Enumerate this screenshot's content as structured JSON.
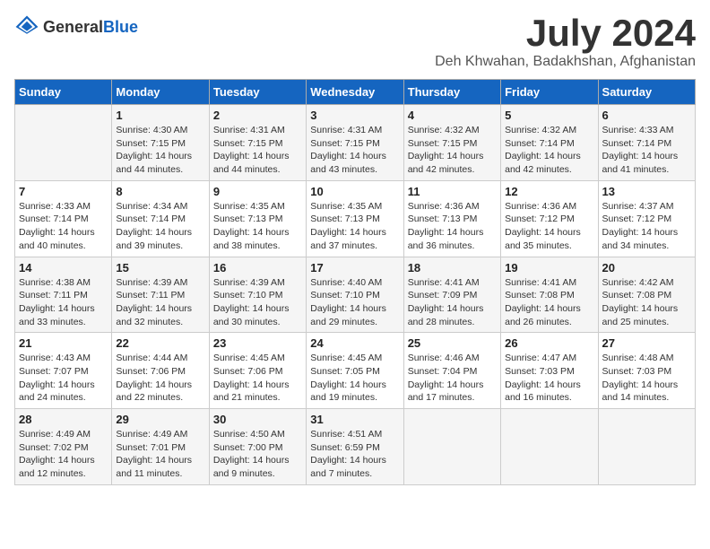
{
  "header": {
    "logo_general": "General",
    "logo_blue": "Blue",
    "month_year": "July 2024",
    "location": "Deh Khwahan, Badakhshan, Afghanistan"
  },
  "days_of_week": [
    "Sunday",
    "Monday",
    "Tuesday",
    "Wednesday",
    "Thursday",
    "Friday",
    "Saturday"
  ],
  "weeks": [
    [
      {
        "day": "",
        "info": ""
      },
      {
        "day": "1",
        "info": "Sunrise: 4:30 AM\nSunset: 7:15 PM\nDaylight: 14 hours\nand 44 minutes."
      },
      {
        "day": "2",
        "info": "Sunrise: 4:31 AM\nSunset: 7:15 PM\nDaylight: 14 hours\nand 44 minutes."
      },
      {
        "day": "3",
        "info": "Sunrise: 4:31 AM\nSunset: 7:15 PM\nDaylight: 14 hours\nand 43 minutes."
      },
      {
        "day": "4",
        "info": "Sunrise: 4:32 AM\nSunset: 7:15 PM\nDaylight: 14 hours\nand 42 minutes."
      },
      {
        "day": "5",
        "info": "Sunrise: 4:32 AM\nSunset: 7:14 PM\nDaylight: 14 hours\nand 42 minutes."
      },
      {
        "day": "6",
        "info": "Sunrise: 4:33 AM\nSunset: 7:14 PM\nDaylight: 14 hours\nand 41 minutes."
      }
    ],
    [
      {
        "day": "7",
        "info": "Sunrise: 4:33 AM\nSunset: 7:14 PM\nDaylight: 14 hours\nand 40 minutes."
      },
      {
        "day": "8",
        "info": "Sunrise: 4:34 AM\nSunset: 7:14 PM\nDaylight: 14 hours\nand 39 minutes."
      },
      {
        "day": "9",
        "info": "Sunrise: 4:35 AM\nSunset: 7:13 PM\nDaylight: 14 hours\nand 38 minutes."
      },
      {
        "day": "10",
        "info": "Sunrise: 4:35 AM\nSunset: 7:13 PM\nDaylight: 14 hours\nand 37 minutes."
      },
      {
        "day": "11",
        "info": "Sunrise: 4:36 AM\nSunset: 7:13 PM\nDaylight: 14 hours\nand 36 minutes."
      },
      {
        "day": "12",
        "info": "Sunrise: 4:36 AM\nSunset: 7:12 PM\nDaylight: 14 hours\nand 35 minutes."
      },
      {
        "day": "13",
        "info": "Sunrise: 4:37 AM\nSunset: 7:12 PM\nDaylight: 14 hours\nand 34 minutes."
      }
    ],
    [
      {
        "day": "14",
        "info": "Sunrise: 4:38 AM\nSunset: 7:11 PM\nDaylight: 14 hours\nand 33 minutes."
      },
      {
        "day": "15",
        "info": "Sunrise: 4:39 AM\nSunset: 7:11 PM\nDaylight: 14 hours\nand 32 minutes."
      },
      {
        "day": "16",
        "info": "Sunrise: 4:39 AM\nSunset: 7:10 PM\nDaylight: 14 hours\nand 30 minutes."
      },
      {
        "day": "17",
        "info": "Sunrise: 4:40 AM\nSunset: 7:10 PM\nDaylight: 14 hours\nand 29 minutes."
      },
      {
        "day": "18",
        "info": "Sunrise: 4:41 AM\nSunset: 7:09 PM\nDaylight: 14 hours\nand 28 minutes."
      },
      {
        "day": "19",
        "info": "Sunrise: 4:41 AM\nSunset: 7:08 PM\nDaylight: 14 hours\nand 26 minutes."
      },
      {
        "day": "20",
        "info": "Sunrise: 4:42 AM\nSunset: 7:08 PM\nDaylight: 14 hours\nand 25 minutes."
      }
    ],
    [
      {
        "day": "21",
        "info": "Sunrise: 4:43 AM\nSunset: 7:07 PM\nDaylight: 14 hours\nand 24 minutes."
      },
      {
        "day": "22",
        "info": "Sunrise: 4:44 AM\nSunset: 7:06 PM\nDaylight: 14 hours\nand 22 minutes."
      },
      {
        "day": "23",
        "info": "Sunrise: 4:45 AM\nSunset: 7:06 PM\nDaylight: 14 hours\nand 21 minutes."
      },
      {
        "day": "24",
        "info": "Sunrise: 4:45 AM\nSunset: 7:05 PM\nDaylight: 14 hours\nand 19 minutes."
      },
      {
        "day": "25",
        "info": "Sunrise: 4:46 AM\nSunset: 7:04 PM\nDaylight: 14 hours\nand 17 minutes."
      },
      {
        "day": "26",
        "info": "Sunrise: 4:47 AM\nSunset: 7:03 PM\nDaylight: 14 hours\nand 16 minutes."
      },
      {
        "day": "27",
        "info": "Sunrise: 4:48 AM\nSunset: 7:03 PM\nDaylight: 14 hours\nand 14 minutes."
      }
    ],
    [
      {
        "day": "28",
        "info": "Sunrise: 4:49 AM\nSunset: 7:02 PM\nDaylight: 14 hours\nand 12 minutes."
      },
      {
        "day": "29",
        "info": "Sunrise: 4:49 AM\nSunset: 7:01 PM\nDaylight: 14 hours\nand 11 minutes."
      },
      {
        "day": "30",
        "info": "Sunrise: 4:50 AM\nSunset: 7:00 PM\nDaylight: 14 hours\nand 9 minutes."
      },
      {
        "day": "31",
        "info": "Sunrise: 4:51 AM\nSunset: 6:59 PM\nDaylight: 14 hours\nand 7 minutes."
      },
      {
        "day": "",
        "info": ""
      },
      {
        "day": "",
        "info": ""
      },
      {
        "day": "",
        "info": ""
      }
    ]
  ]
}
